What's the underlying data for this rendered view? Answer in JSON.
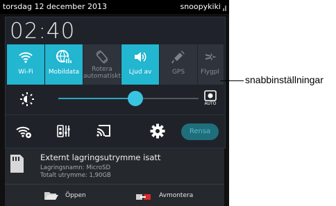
{
  "status_bar": {
    "date": "torsdag 12 december 2013",
    "user": "snoopykiki"
  },
  "clock": "02:40",
  "tiles": [
    {
      "label": "Wi-Fi",
      "state": "on",
      "icon": "wifi-icon"
    },
    {
      "label": "Mobildata",
      "state": "on",
      "icon": "mobile-data-icon"
    },
    {
      "label": "Rotera automatiskt",
      "label_lines": [
        "Rotera",
        "automatiskt"
      ],
      "state": "off",
      "icon": "rotate-icon"
    },
    {
      "label": "Ljud av",
      "state": "on",
      "icon": "volume-icon"
    },
    {
      "label": "GPS",
      "state": "off",
      "icon": "gps-icon"
    },
    {
      "label": "Flygpl",
      "state": "off",
      "icon": "airplane-icon"
    }
  ],
  "brightness": {
    "level_percent": 59,
    "auto_icon": "auto-brightness-icon",
    "auto_label": "AUTO"
  },
  "actions": {
    "rensa_label": "Rensa",
    "icons": [
      "wifi-settings-icon",
      "equalizer-icon",
      "screen-cast-icon",
      "settings-gear-icon"
    ]
  },
  "notification": {
    "title": "Externt lagringsutrymme isatt",
    "line1": "Lagringsnamn: MicroSD",
    "line2": "Totalt utrymme: 1,90GB",
    "open_label": "Öppen",
    "unmount_label": "Avmontera",
    "icon": "sd-card-icon"
  },
  "callout": "snabbinställningar",
  "colors": {
    "accent": "#22b6d0",
    "tile_off": "#2f343c",
    "panel": "#1f2329"
  }
}
